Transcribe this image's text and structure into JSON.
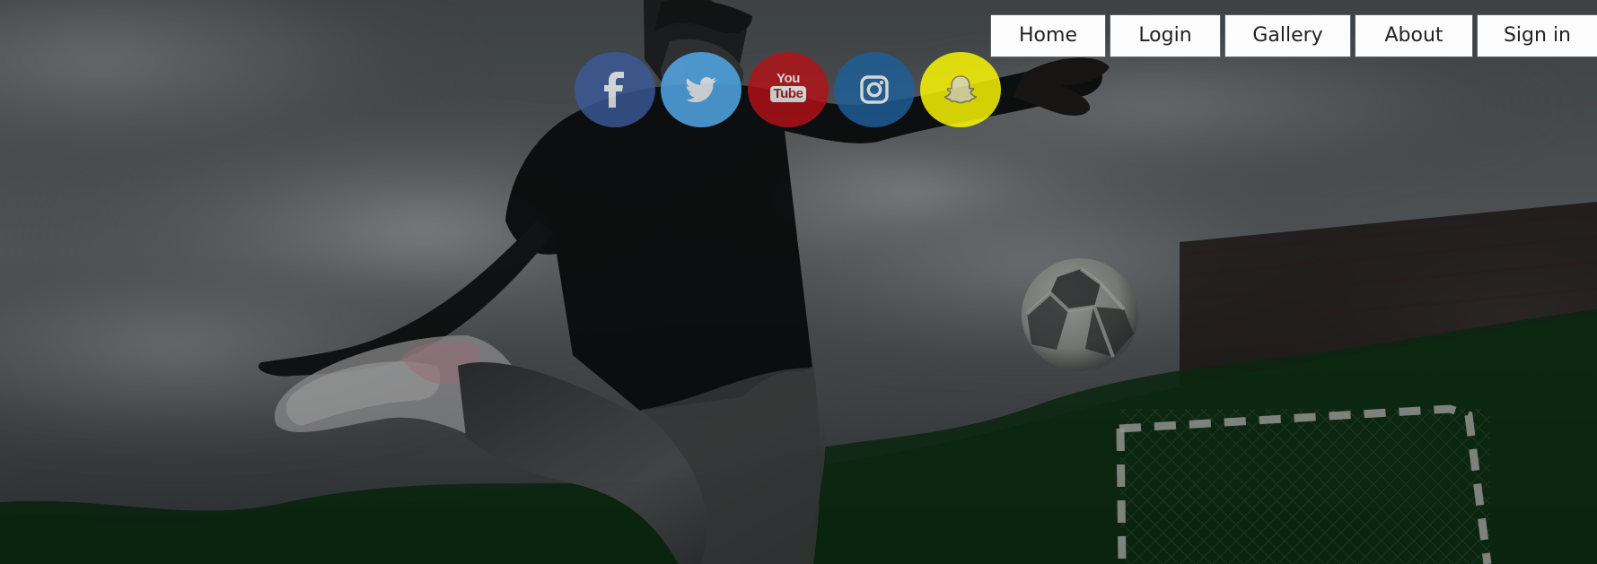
{
  "navigation": {
    "items": [
      {
        "label": "Home"
      },
      {
        "label": "Login"
      },
      {
        "label": "Gallery"
      },
      {
        "label": "About"
      },
      {
        "label": "Sign in"
      }
    ]
  },
  "social": {
    "links": [
      {
        "icon": "facebook-icon",
        "color": "#3b5998"
      },
      {
        "icon": "twitter-icon",
        "color": "#55acee"
      },
      {
        "icon": "youtube-icon",
        "color": "#b31217",
        "you": "You",
        "tube": "Tube"
      },
      {
        "icon": "instagram-icon",
        "color": "#1e5f98"
      },
      {
        "icon": "snapchat-icon",
        "color": "#fffc00"
      }
    ]
  },
  "colors": {
    "overlay": "#000000",
    "turf": "#11401f",
    "sky": "#71787c"
  }
}
